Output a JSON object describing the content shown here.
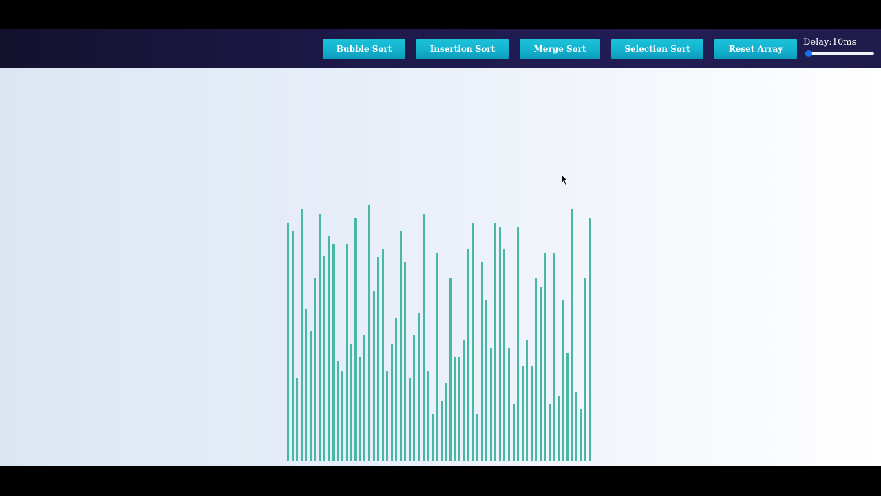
{
  "toolbar": {
    "buttons": [
      {
        "label": "Bubble Sort"
      },
      {
        "label": "Insertion Sort"
      },
      {
        "label": "Merge Sort"
      },
      {
        "label": "Selection Sort"
      },
      {
        "label": "Reset Array"
      }
    ],
    "delay_label": "Delay:10ms",
    "delay_value_ms": 10,
    "delay_slider_fraction": 0.0
  },
  "colors": {
    "bar": "#48b8a5",
    "button": "#14b2cf",
    "navbar": "#1e1a4c",
    "slider_thumb": "#1a6ef0"
  },
  "array": {
    "values": [
      346,
      333,
      120,
      366,
      220,
      189,
      265,
      359,
      297,
      327,
      315,
      145,
      131,
      315,
      170,
      353,
      151,
      182,
      372,
      246,
      296,
      308,
      131,
      170,
      208,
      333,
      289,
      120,
      182,
      214,
      359,
      131,
      68,
      302,
      87,
      113,
      265,
      151,
      151,
      176,
      308,
      346,
      68,
      289,
      233,
      164,
      346,
      340,
      308,
      164,
      82,
      340,
      138,
      176,
      138,
      265,
      252,
      302,
      82,
      302,
      94,
      233,
      157,
      366,
      100,
      75,
      265,
      353
    ]
  }
}
